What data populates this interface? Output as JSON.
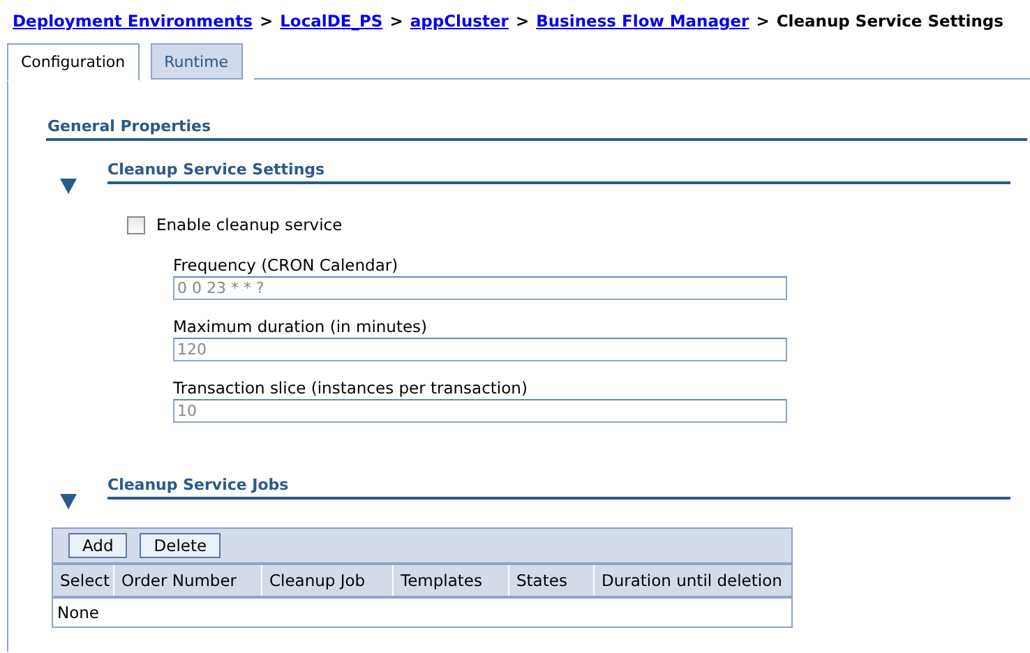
{
  "breadcrumb": [
    {
      "label": "Deployment Environments",
      "link": true
    },
    {
      "label": "LocalDE_PS",
      "link": true
    },
    {
      "label": "appCluster",
      "link": true
    },
    {
      "label": "Business Flow Manager",
      "link": true
    },
    {
      "label": "Cleanup Service Settings",
      "link": false
    }
  ],
  "breadcrumb_separator": ">",
  "tabs": [
    {
      "label": "Configuration",
      "selected": true
    },
    {
      "label": "Runtime",
      "selected": false
    }
  ],
  "general_properties": {
    "title": "General Properties"
  },
  "settings_section": {
    "title": "Cleanup Service Settings",
    "expanded": true,
    "enable_checkbox": {
      "label": "Enable cleanup service",
      "checked": false
    },
    "fields": [
      {
        "label": "Frequency (CRON Calendar)",
        "value": "0 0 23 * * ?"
      },
      {
        "label": "Maximum duration (in minutes)",
        "value": "120"
      },
      {
        "label": "Transaction slice (instances per transaction)",
        "value": "10"
      }
    ]
  },
  "jobs_section": {
    "title": "Cleanup Service Jobs",
    "expanded": true,
    "buttons": [
      "Add",
      "Delete"
    ],
    "table": {
      "columns": [
        "Select",
        "Order Number",
        "Cleanup Job",
        "Templates",
        "States",
        "Duration until deletion"
      ],
      "empty_text": "None"
    }
  }
}
